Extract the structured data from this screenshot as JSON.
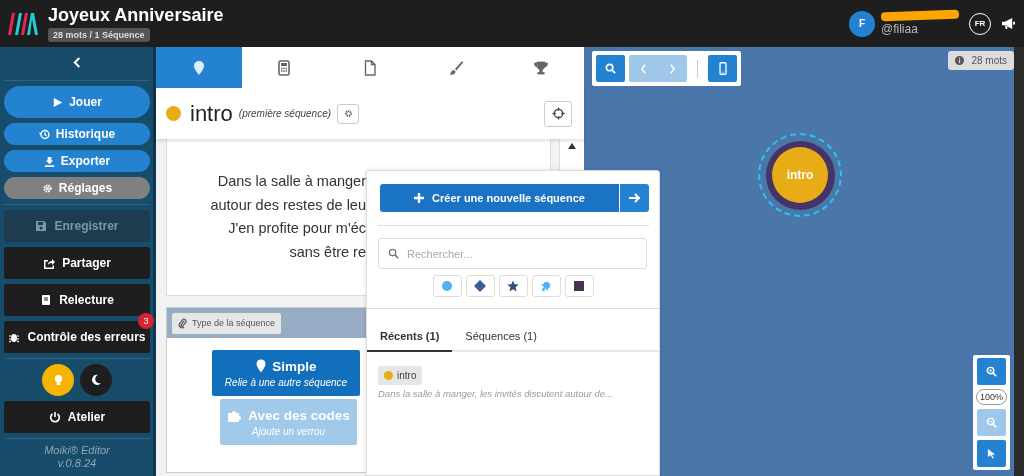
{
  "header": {
    "title": "Joyeux Anniversaire",
    "stats": "28 mots / 1 Séquence",
    "user": {
      "initial": "F",
      "handle": "@filiaa"
    },
    "language": "FR"
  },
  "sidebar": {
    "primary": [
      {
        "label": "Jouer",
        "kind": "large"
      },
      {
        "label": "Historique",
        "kind": "pill"
      },
      {
        "label": "Exporter",
        "kind": "pill"
      },
      {
        "label": "Réglages",
        "kind": "muted"
      }
    ],
    "actions": [
      {
        "label": "Enregistrer",
        "disabled": true
      },
      {
        "label": "Partager",
        "disabled": false
      },
      {
        "label": "Relecture",
        "disabled": false
      },
      {
        "label": "Contrôle des erreurs",
        "disabled": false,
        "badge": "3"
      }
    ],
    "themes": [
      {
        "kind": "light",
        "selected": true
      },
      {
        "kind": "dark",
        "selected": false
      }
    ],
    "workshop": "Atelier",
    "product": "Moiki® Editor",
    "version": "v.0.8.24"
  },
  "editor": {
    "tabs": [
      {
        "selected": true
      },
      {
        "selected": false
      },
      {
        "selected": false
      },
      {
        "selected": false
      },
      {
        "selected": false
      }
    ],
    "sequence": {
      "name": "intro",
      "note": "(première séquence)"
    },
    "text_lines": [
      "Dans la salle à manger",
      "autour des restes de leu",
      "J'en profite pour m'éc",
      "sans être re"
    ],
    "type_section": {
      "label": "Type de la séquence",
      "options": [
        {
          "title": "Simple",
          "subtitle": "Relie à une autre séquence",
          "selected": true
        },
        {
          "title": "Avec des codes",
          "subtitle": "Ajoute un verrou",
          "selected": false
        }
      ]
    }
  },
  "popup": {
    "create": "Créer une nouvelle séquence",
    "search_placeholder": "Rechercher...",
    "tabs": [
      {
        "label": "Récents (1)",
        "selected": true
      },
      {
        "label": "Séquences (1)",
        "selected": false
      }
    ],
    "items": [
      {
        "name": "intro",
        "excerpt": "Dans la salle à manger, les invités discutent autour de..."
      }
    ]
  },
  "canvas": {
    "word_count": "28 mots",
    "nodes": [
      {
        "label": "intro"
      }
    ],
    "zoom": "100%"
  }
}
